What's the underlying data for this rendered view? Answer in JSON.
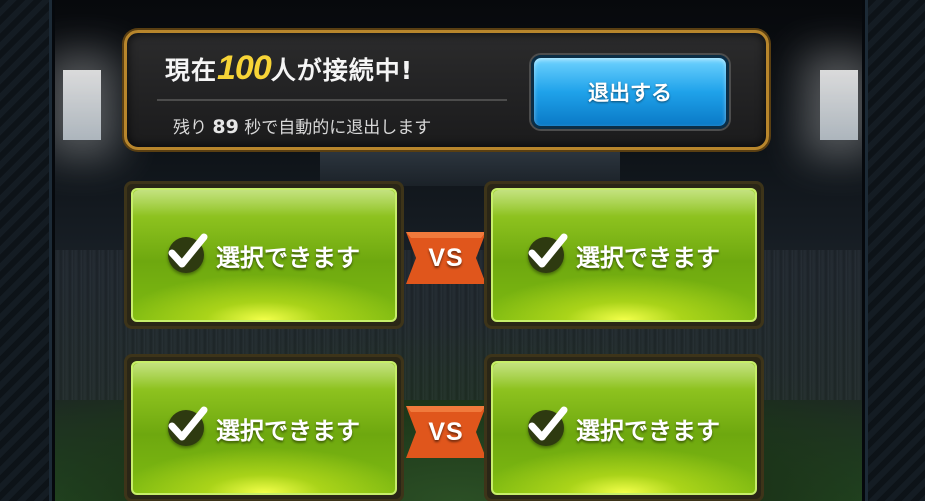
{
  "header": {
    "title_prefix": "現在",
    "connected_count": "100",
    "title_suffix": "人が接続中!",
    "countdown_prefix": "残り",
    "countdown_seconds": "89",
    "countdown_suffix": "秒で自動的に退出します",
    "exit_button_label": "退出する"
  },
  "matchups": [
    {
      "left_label": "選択できます",
      "vs_label": "VS",
      "right_label": "選択できます"
    },
    {
      "left_label": "選択できます",
      "vs_label": "VS",
      "right_label": "選択できます"
    }
  ],
  "colors": {
    "accent_gold": "#b8862c",
    "count_yellow": "#f7d437",
    "exit_blue": "#1fa2ea",
    "card_green": "#8cc11e",
    "vs_orange": "#e0561c"
  },
  "icons": {
    "card_icon": "checkmark-icon",
    "vs_shape": "ribbon-banner"
  }
}
